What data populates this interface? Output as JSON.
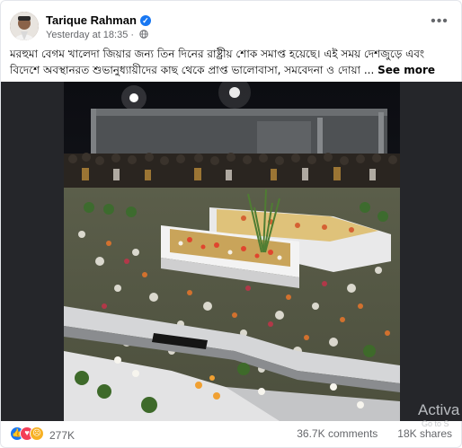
{
  "post": {
    "author": "Tarique Rahman",
    "timestamp": "Yesterday at 18:35",
    "more_icon": "more-horizontal-icon",
    "caption": "মরহুমা বেগম খালেদা জিয়ার জন্য তিন দিনের রাষ্ট্রীয় শোক সমাপ্ত হয়েছে। এই সময় দেশজুড়ে এবং বিদেশে অবস্থানরত শুভানুধ্যায়ীদের কাছ থেকে প্রাপ্ত ভালোবাসা, সমবেদনা ও দোয়া ...",
    "see_more": "See more"
  },
  "reactions": {
    "icons": [
      "like-icon",
      "love-icon",
      "sad-icon"
    ],
    "count": "277K"
  },
  "stats": {
    "comments": "36.7K comments",
    "shares": "18K shares"
  },
  "overlay": {
    "watermark": "Activa",
    "watermark_sub": "Go to S"
  },
  "colors": {
    "accent": "#1877f2",
    "text_secondary": "#65676b",
    "media_bg": "#25262a"
  }
}
